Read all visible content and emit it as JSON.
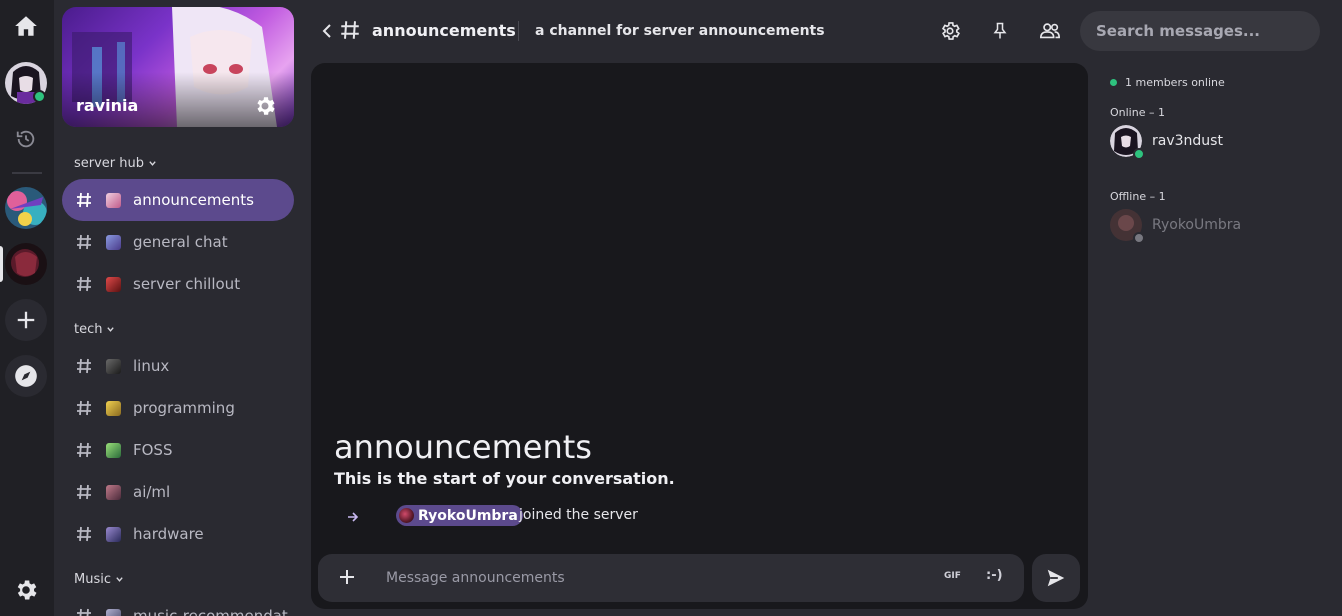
{
  "rail": {
    "icons": [
      "home-icon",
      "history-icon",
      "add-server-icon",
      "explore-icon",
      "settings-icon"
    ]
  },
  "server": {
    "name": "ravinia"
  },
  "sidebar": {
    "categories": [
      {
        "label": "server hub",
        "channels": [
          {
            "label": "announcements",
            "active": true
          },
          {
            "label": "general chat"
          },
          {
            "label": "server chillout"
          }
        ]
      },
      {
        "label": "tech",
        "channels": [
          {
            "label": "linux"
          },
          {
            "label": "programming"
          },
          {
            "label": "FOSS"
          },
          {
            "label": "ai/ml"
          },
          {
            "label": "hardware"
          }
        ]
      },
      {
        "label": "Music",
        "channels": [
          {
            "label": "music-recommendat"
          }
        ]
      }
    ]
  },
  "header": {
    "channel_name": "announcements",
    "topic": "a channel for server announcements",
    "icons": [
      "settings-icon",
      "pin-icon",
      "members-icon"
    ]
  },
  "search": {
    "placeholder": "Search messages..."
  },
  "chat": {
    "welcome_title": "announcements",
    "welcome_subtitle": "This is the start of your conversation.",
    "events": [
      {
        "user": "RyokoUmbra",
        "text": "joined the server"
      }
    ]
  },
  "composer": {
    "placeholder": "Message announcements",
    "gif_label": "GIF",
    "emoji_label": ":-)"
  },
  "members": {
    "online_summary": "1 members online",
    "online_label": "Online – 1",
    "offline_label": "Offline – 1",
    "online": [
      {
        "name": "rav3ndust"
      }
    ],
    "offline": [
      {
        "name": "RyokoUmbra"
      }
    ]
  },
  "colors": {
    "accent": "#5c4a8d",
    "online": "#2ec27e",
    "offline": "#8a8a94"
  }
}
